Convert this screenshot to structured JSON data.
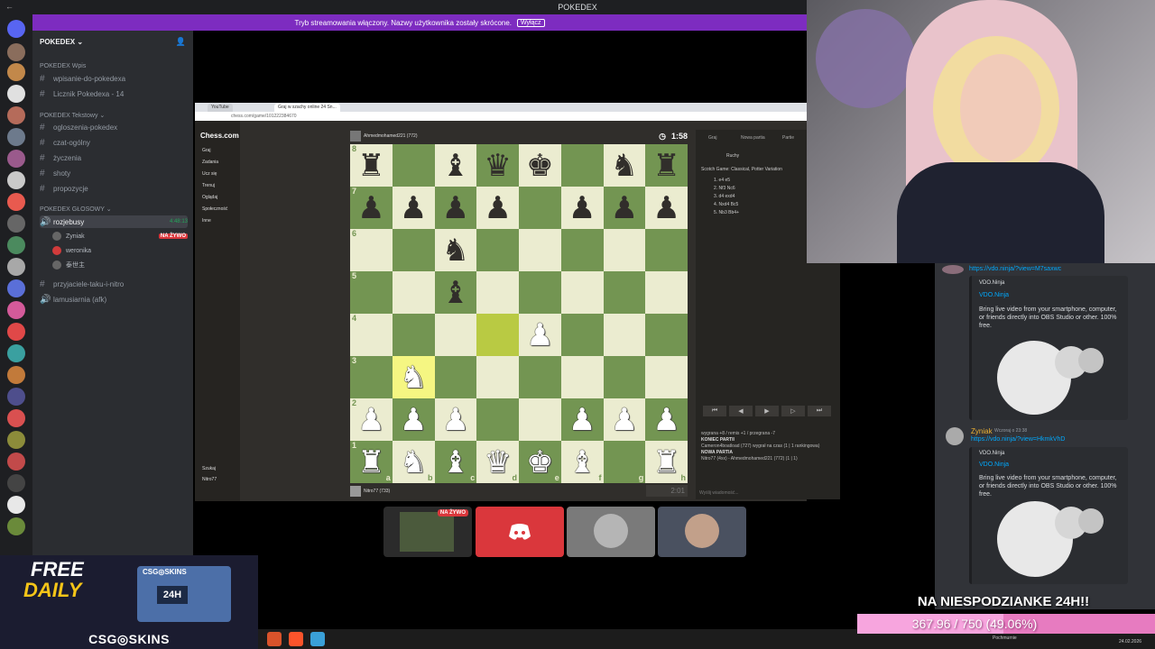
{
  "window": {
    "title": "POKEDEX",
    "back": "←"
  },
  "stream_notice": {
    "text": "Tryb streamowania włączony. Nazwy użytkownika zostały skrócone.",
    "button": "Wyłącz"
  },
  "sidebar": {
    "guild": "POKEDEX",
    "categories": [
      {
        "name": "POKEDEX Wpis",
        "channels": [
          "wpisanie-do-pokedexa",
          "Licznik Pokedexa - 14"
        ]
      },
      {
        "name": "POKEDEX Tekstowy",
        "channels": [
          "ogloszenia-pokedex",
          "czat-ogólny",
          "życzenia",
          "shoty",
          "propozycje"
        ]
      },
      {
        "name": "POKEDEX GŁOSOWY",
        "channels": [
          "rozjebusy"
        ]
      }
    ],
    "voice_active": {
      "name": "rozjebusy",
      "time": "4:48:13"
    },
    "voice_users": [
      {
        "name": "Zyniak",
        "live": "NA ŻYWO"
      },
      {
        "name": "weronika",
        "live": ""
      },
      {
        "name": "泰世主",
        "live": ""
      }
    ],
    "more_channels": [
      "przyjaciele-taku-i-nitro",
      "lamusiarnia (afk)"
    ]
  },
  "browser": {
    "tabs": [
      "YouTube",
      "Graj w szachy online 24 Sn..."
    ],
    "url": "chess.com/game/101222384670",
    "logo": "Chess.com",
    "nav": [
      "Graj",
      "Zadania",
      "Ucz się",
      "Trenuj",
      "Oglądaj",
      "Społeczność",
      "Inne"
    ],
    "search": "Szukaj",
    "bottom_user": "Nitro77"
  },
  "chess": {
    "top_player": "Ahmedmohamed221 (772)",
    "top_time": "1:58",
    "bottom_player": "Nitro77 (733)",
    "bottom_time": "2:01",
    "ranks": [
      "8",
      "7",
      "6",
      "5",
      "4",
      "3",
      "2",
      "1"
    ],
    "files": [
      "a",
      "b",
      "c",
      "d",
      "e",
      "f",
      "g",
      "h"
    ],
    "position": [
      [
        "br",
        "",
        "bb",
        "bq",
        "bk",
        "",
        "bn",
        "br"
      ],
      [
        "bp",
        "bp",
        "bp",
        "bp",
        "",
        "bp",
        "bp",
        "bp"
      ],
      [
        "",
        "",
        "bn",
        "",
        "",
        "",
        "",
        ""
      ],
      [
        "",
        "",
        "bb",
        "",
        "",
        "",
        "",
        ""
      ],
      [
        "",
        "",
        "",
        "",
        "wp",
        "",
        "",
        ""
      ],
      [
        "",
        "wn",
        "",
        "",
        "",
        "",
        "",
        ""
      ],
      [
        "wp",
        "wp",
        "wp",
        "",
        "",
        "wp",
        "wp",
        "wp"
      ],
      [
        "wr",
        "wn",
        "wb",
        "wq",
        "wk",
        "wb",
        "",
        "wr"
      ]
    ],
    "highlights": [
      [
        4,
        3
      ],
      [
        5,
        1
      ]
    ],
    "panel": {
      "tabs": [
        "Graj",
        "Nowa partia",
        "Partie"
      ],
      "subtab": "Ruchy",
      "opening": "Scotch Game: Classical, Potter Variation",
      "moves": [
        "1. e4   e5",
        "2. Nf3  Nc6",
        "3. d4   exd4",
        "4. Nxd4 Bc5",
        "5. Nb3  Bb4+"
      ],
      "nav": [
        "⏮",
        "◀",
        "▶",
        "▷",
        "⏭"
      ],
      "chat": [
        "wygrana +8 / remis +1 / przegrana -7",
        "KONIEC PARTII",
        "Cameron4boatload (727) wygrał na czas (1 | 1 rankingowa)",
        "NOWA PARTIA",
        "Nitro77 (4xx) - Ahmedmohamed221 (772) (1 | 1)"
      ],
      "input_placeholder": "Wyślij wiadomość..."
    }
  },
  "tiles": {
    "live_badge": "NA ŻYWO"
  },
  "chat": {
    "messages": [
      {
        "link": "https://vdo.ninja/?view=M7saxwc",
        "embed_title": "VDO.Ninja",
        "embed_desc": "Bring live video from your smartphone, computer, or friends directly into OBS Studio or other. 100% free."
      },
      {
        "author": "Zyniak",
        "time": "Wczoraj o 23:38",
        "link": "https://vdo.ninja/?view=HkmkVhD",
        "embed_title": "VDO.Ninja",
        "embed_desc": "Bring live video from your smartphone, computer, or friends directly into OBS Studio or other. 100% free."
      }
    ]
  },
  "overlay": {
    "ad_free": "FREE",
    "ad_daily": "DAILY",
    "ad_brand": "CSG◎SKINS",
    "ad_box": "CSG◎SKINS",
    "ad_box_label": "24H",
    "goal_title": "NA NIESPODZIANKE 24H!!",
    "goal_text": "367.96 / 750 (49.06%)",
    "goal_fraction": 0.4906
  },
  "taskbar": {
    "weather": "Pochmurnie",
    "date": "24.02.2026"
  },
  "colors": {
    "discord_bg": "#313338",
    "chess_light": "#ebecd0",
    "chess_dark": "#739552",
    "stream_purple": "#7d2cc0",
    "goal_pink": "#e77bc0"
  }
}
